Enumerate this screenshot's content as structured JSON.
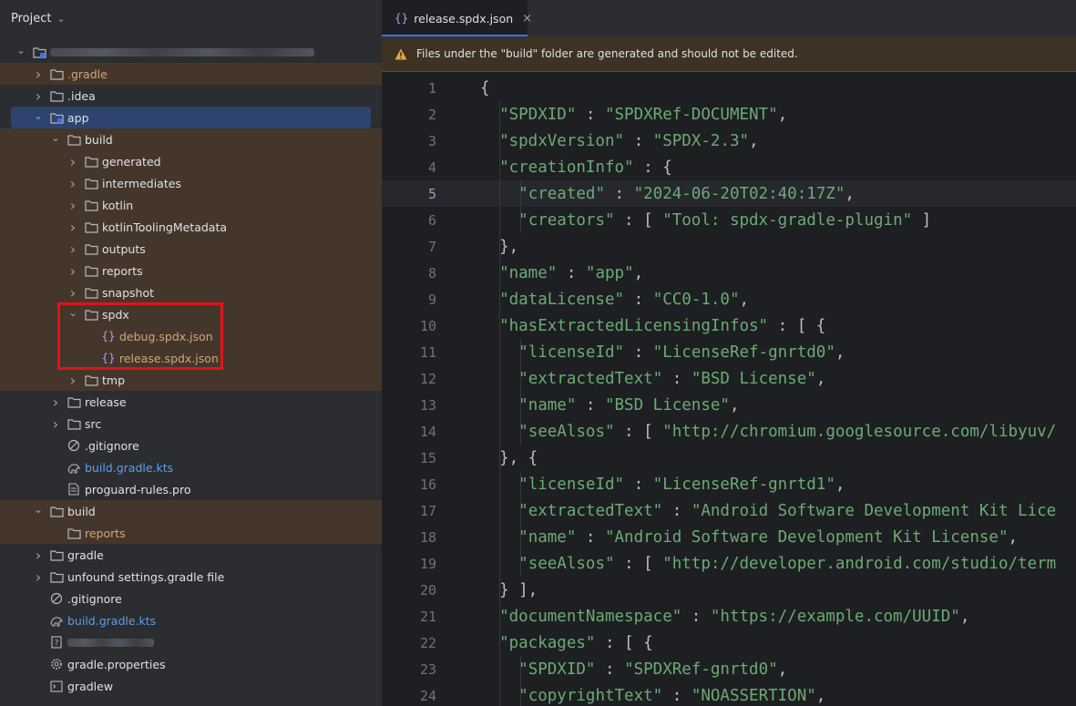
{
  "project": {
    "title": "Project",
    "tree": [
      {
        "label": "",
        "blurred": true,
        "arrow": "open",
        "indent": 0,
        "icon": "module-folder-icon"
      },
      {
        "label": ".gradle",
        "arrow": "closed",
        "indent": 1,
        "icon": "folder-icon",
        "brown": true,
        "dim": true
      },
      {
        "label": ".idea",
        "arrow": "closed",
        "indent": 1,
        "icon": "folder-icon"
      },
      {
        "label": "app",
        "arrow": "open",
        "indent": 1,
        "icon": "module-folder-icon",
        "selected": true
      },
      {
        "label": "build",
        "arrow": "open",
        "indent": 2,
        "icon": "folder-icon",
        "brown": true
      },
      {
        "label": "generated",
        "arrow": "closed",
        "indent": 3,
        "icon": "folder-icon",
        "brown": true
      },
      {
        "label": "intermediates",
        "arrow": "closed",
        "indent": 3,
        "icon": "folder-icon",
        "brown": true
      },
      {
        "label": "kotlin",
        "arrow": "closed",
        "indent": 3,
        "icon": "folder-icon",
        "brown": true
      },
      {
        "label": "kotlinToolingMetadata",
        "arrow": "closed",
        "indent": 3,
        "icon": "folder-icon",
        "brown": true
      },
      {
        "label": "outputs",
        "arrow": "closed",
        "indent": 3,
        "icon": "folder-icon",
        "brown": true
      },
      {
        "label": "reports",
        "arrow": "closed",
        "indent": 3,
        "icon": "folder-icon",
        "brown": true
      },
      {
        "label": "snapshot",
        "arrow": "closed",
        "indent": 3,
        "icon": "folder-icon",
        "brown": true
      },
      {
        "label": "spdx",
        "arrow": "open",
        "indent": 3,
        "icon": "folder-icon",
        "brown": true
      },
      {
        "label": "debug.spdx.json",
        "arrow": "none",
        "indent": 4,
        "icon": "json-file-icon",
        "brown": true,
        "dim": true
      },
      {
        "label": "release.spdx.json",
        "arrow": "none",
        "indent": 4,
        "icon": "json-file-icon",
        "brown": true,
        "dim": true
      },
      {
        "label": "tmp",
        "arrow": "closed",
        "indent": 3,
        "icon": "folder-icon",
        "brown": true
      },
      {
        "label": "release",
        "arrow": "closed",
        "indent": 2,
        "icon": "folder-icon"
      },
      {
        "label": "src",
        "arrow": "closed",
        "indent": 2,
        "icon": "folder-icon"
      },
      {
        "label": ".gitignore",
        "arrow": "none",
        "indent": 2,
        "icon": "gitignore-icon"
      },
      {
        "label": "build.gradle.kts",
        "arrow": "none",
        "indent": 2,
        "icon": "gradle-icon",
        "blue": true
      },
      {
        "label": "proguard-rules.pro",
        "arrow": "none",
        "indent": 2,
        "icon": "text-file-icon"
      },
      {
        "label": "build",
        "arrow": "open",
        "indent": 1,
        "icon": "folder-icon",
        "brown": true
      },
      {
        "label": "reports",
        "arrow": "none",
        "indent": 2,
        "icon": "folder-icon",
        "brown": true,
        "dim": true
      },
      {
        "label": "gradle",
        "arrow": "closed",
        "indent": 1,
        "icon": "folder-icon"
      },
      {
        "label": "unfound settings.gradle file",
        "arrow": "closed",
        "indent": 1,
        "icon": "folder-icon"
      },
      {
        "label": ".gitignore",
        "arrow": "none",
        "indent": 1,
        "icon": "gitignore-icon"
      },
      {
        "label": "build.gradle.kts",
        "arrow": "none",
        "indent": 1,
        "icon": "gradle-icon",
        "blue": true
      },
      {
        "label": "",
        "blurred": true,
        "arrow": "none",
        "indent": 1,
        "icon": "unknown-file-icon"
      },
      {
        "label": "gradle.properties",
        "arrow": "none",
        "indent": 1,
        "icon": "settings-file-icon"
      },
      {
        "label": "gradlew",
        "arrow": "none",
        "indent": 1,
        "icon": "terminal-file-icon"
      }
    ]
  },
  "editor": {
    "tab_label": "release.spdx.json",
    "tab_close": "×",
    "notice": "Files under the \"build\" folder are generated and should not be edited.",
    "current_line": 5,
    "lines": [
      {
        "n": "1",
        "t": "{"
      },
      {
        "n": "2",
        "t": "  \"SPDXID\" : \"SPDXRef-DOCUMENT\","
      },
      {
        "n": "3",
        "t": "  \"spdxVersion\" : \"SPDX-2.3\","
      },
      {
        "n": "4",
        "t": "  \"creationInfo\" : {"
      },
      {
        "n": "5",
        "t": "    \"created\" : \"2024-06-20T02:40:17Z\","
      },
      {
        "n": "6",
        "t": "    \"creators\" : [ \"Tool: spdx-gradle-plugin\" ]"
      },
      {
        "n": "7",
        "t": "  },"
      },
      {
        "n": "8",
        "t": "  \"name\" : \"app\","
      },
      {
        "n": "9",
        "t": "  \"dataLicense\" : \"CC0-1.0\","
      },
      {
        "n": "10",
        "t": "  \"hasExtractedLicensingInfos\" : [ {"
      },
      {
        "n": "11",
        "t": "    \"licenseId\" : \"LicenseRef-gnrtd0\","
      },
      {
        "n": "12",
        "t": "    \"extractedText\" : \"BSD License\","
      },
      {
        "n": "13",
        "t": "    \"name\" : \"BSD License\","
      },
      {
        "n": "14",
        "t": "    \"seeAlsos\" : [ \"http://chromium.googlesource.com/libyuv/"
      },
      {
        "n": "15",
        "t": "  }, {"
      },
      {
        "n": "16",
        "t": "    \"licenseId\" : \"LicenseRef-gnrtd1\","
      },
      {
        "n": "17",
        "t": "    \"extractedText\" : \"Android Software Development Kit Lice"
      },
      {
        "n": "18",
        "t": "    \"name\" : \"Android Software Development Kit License\","
      },
      {
        "n": "19",
        "t": "    \"seeAlsos\" : [ \"http://developer.android.com/studio/term"
      },
      {
        "n": "20",
        "t": "  } ],"
      },
      {
        "n": "21",
        "t": "  \"documentNamespace\" : \"https://example.com/UUID\","
      },
      {
        "n": "22",
        "t": "  \"packages\" : [ {"
      },
      {
        "n": "23",
        "t": "    \"SPDXID\" : \"SPDXRef-gnrtd0\","
      },
      {
        "n": "24",
        "t": "    \"copyrightText\" : \"NOASSERTION\","
      }
    ]
  },
  "colors": {
    "accent": "#3574f0",
    "highlight_box": "#e3121a",
    "excluded_folder_bg": "#45362b",
    "string": "#6aab73"
  }
}
